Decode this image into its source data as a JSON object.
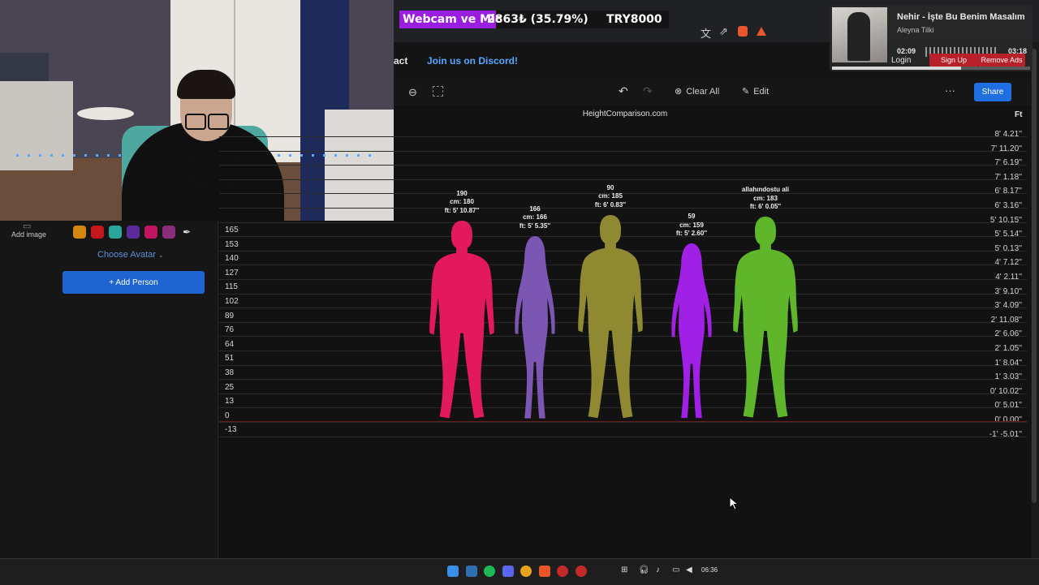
{
  "overlay": {
    "donation_label": "Webcam ve Mic",
    "donation_amount": "2863₺ (35.79%)",
    "donation_goal": "TRY8000",
    "donation_progress": 0.3579
  },
  "browser": {
    "icons": [
      "translate-icon",
      "share-icon",
      "brave-shield-icon",
      "brave-rewards-icon"
    ]
  },
  "music": {
    "title": "Nehir - İşte Bu Benim Masalım",
    "artist": "Aleyna Tilki",
    "elapsed": "02:09",
    "duration": "03:18",
    "progress": 0.652
  },
  "header": {
    "contact_partial": "act",
    "discord_link": "Join us on Discord!",
    "login": "Login",
    "signup": "Sign Up",
    "remove_ads": "Remove Ads"
  },
  "toolbar": {
    "clear_all": "Clear All",
    "edit": "Edit",
    "share": "Share",
    "more": "···"
  },
  "chart": {
    "title": "HeightComparison.com",
    "right_unit": "Ft",
    "cm_ticks": [
      "165",
      "153",
      "140",
      "127",
      "115",
      "102",
      "89",
      "76",
      "64",
      "51",
      "38",
      "25",
      "13",
      "0",
      "-13"
    ],
    "ft_ticks": [
      "8' 4.21''",
      "7' 11.20''",
      "7' 6.19''",
      "7' 1.18''",
      "6' 8.17''",
      "6' 3.16''",
      "5' 10.15''",
      "5' 5.14''",
      "5' 0.13''",
      "4' 7.12''",
      "4' 2.11''",
      "3' 9.10''",
      "3' 4.09''",
      "2' 11.08''",
      "2' 6.06''",
      "2' 1.05''",
      "1' 8.04''",
      "1' 3.03''",
      "0' 10.02''",
      "0' 5.01''",
      "0' 0.00''",
      "-1' -5.01''"
    ]
  },
  "chart_data": {
    "type": "bar",
    "title": "HeightComparison.com",
    "categories": [
      "190",
      "166",
      "90",
      "59",
      "allahındostu ali"
    ],
    "values_cm": [
      180,
      166,
      185,
      159,
      183
    ],
    "labels_ft": [
      "ft: 5' 10.87''",
      "ft: 5' 5.35''",
      "ft: 6' 0.83''",
      "ft: 5' 2.60''",
      "ft: 6' 0.05''"
    ],
    "labels_cm": [
      "cm: 180",
      "cm: 166",
      "cm: 185",
      "cm: 159",
      "cm: 183"
    ],
    "colors": [
      "#e3195e",
      "#7b57b3",
      "#8f8a32",
      "#a020e6",
      "#5fb62a"
    ],
    "genders": [
      "male",
      "female",
      "male",
      "female",
      "male"
    ]
  },
  "left_panel": {
    "add_image": "Add image",
    "swatches": [
      "#d4870e",
      "#c4171e",
      "#2aa69a",
      "#5b2b9e",
      "#c21561",
      "#8a2d7a"
    ],
    "choose_avatar": "Choose Avatar",
    "add_person": "+ Add Person"
  },
  "taskbar": {
    "clock": "06:36",
    "icons": [
      "windows-start-icon",
      "settings-icon",
      "spotify-icon",
      "discord-icon",
      "chrome-icon",
      "brave-icon",
      "app-icon",
      "app-icon-2"
    ]
  }
}
